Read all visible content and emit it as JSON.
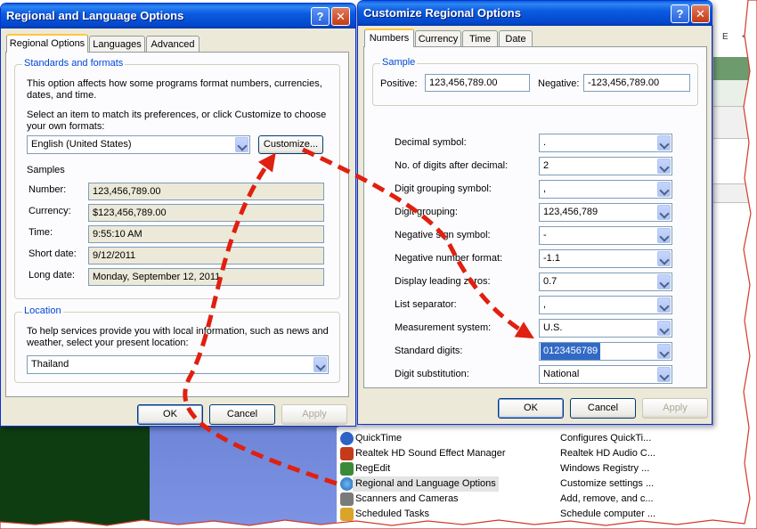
{
  "regional": {
    "title": "Regional and Language Options",
    "tabs": [
      "Regional Options",
      "Languages",
      "Advanced"
    ],
    "standards_legend": "Standards and formats",
    "desc1": "This option affects how some programs format numbers, currencies,",
    "desc2": "dates, and time.",
    "select1": "Select an item to match its preferences, or click Customize to choose",
    "select2": "your own formats:",
    "locale_value": "English (United States)",
    "customize_label": "Customize...",
    "samples_label": "Samples",
    "samples": [
      {
        "label": "Number:",
        "value": "123,456,789.00"
      },
      {
        "label": "Currency:",
        "value": "$123,456,789.00"
      },
      {
        "label": "Time:",
        "value": "9:55:10 AM"
      },
      {
        "label": "Short date:",
        "value": "9/12/2011"
      },
      {
        "label": "Long date:",
        "value": "Monday, September 12, 2011"
      }
    ],
    "location_legend": "Location",
    "loc1": "To help services provide you with local information, such as news and",
    "loc2": "weather, select your present location:",
    "location_value": "Thailand",
    "ok": "OK",
    "cancel": "Cancel",
    "apply": "Apply"
  },
  "customize": {
    "title": "Customize Regional Options",
    "tabs": [
      "Numbers",
      "Currency",
      "Time",
      "Date"
    ],
    "sample_legend": "Sample",
    "positive_label": "Positive:",
    "positive_value": "123,456,789.00",
    "negative_label": "Negative:",
    "negative_value": "-123,456,789.00",
    "settings": [
      {
        "label": "Decimal symbol:",
        "value": "."
      },
      {
        "label": "No. of digits after decimal:",
        "value": "2"
      },
      {
        "label": "Digit grouping symbol:",
        "value": ","
      },
      {
        "label": "Digit grouping:",
        "value": "123,456,789"
      },
      {
        "label": "Negative sign symbol:",
        "value": "-"
      },
      {
        "label": "Negative number format:",
        "value": "-1.1"
      },
      {
        "label": "Display leading zeros:",
        "value": "0.7"
      },
      {
        "label": "List separator:",
        "value": ","
      },
      {
        "label": "Measurement system:",
        "value": "U.S."
      },
      {
        "label": "Standard digits:",
        "value": "0123456789"
      },
      {
        "label": "Digit substitution:",
        "value": "National"
      }
    ],
    "ok": "OK",
    "cancel": "Cancel",
    "apply": "Apply"
  },
  "control_panel": [
    {
      "name": "QuickTime",
      "desc": "Configures QuickTi...",
      "color": "#2d62c8"
    },
    {
      "name": "Realtek HD Sound Effect Manager",
      "desc": "Realtek HD Audio C...",
      "color": "#c43a1a"
    },
    {
      "name": "RegEdit",
      "desc": "Windows Registry ...",
      "color": "#3a8a3a"
    },
    {
      "name": "Regional and Language Options",
      "desc": "Customize settings ...",
      "color": "#2c7dc8"
    },
    {
      "name": "Scanners and Cameras",
      "desc": "Add, remove, and c...",
      "color": "#7a7a7a"
    },
    {
      "name": "Scheduled Tasks",
      "desc": "Schedule computer ...",
      "color": "#d9a42a"
    }
  ],
  "background_right": {
    "text1": "E",
    "text2": "<"
  },
  "colors": {
    "annotation": "#e02010",
    "title_blue": "#0b5ce0",
    "selection": "#316ac5"
  }
}
